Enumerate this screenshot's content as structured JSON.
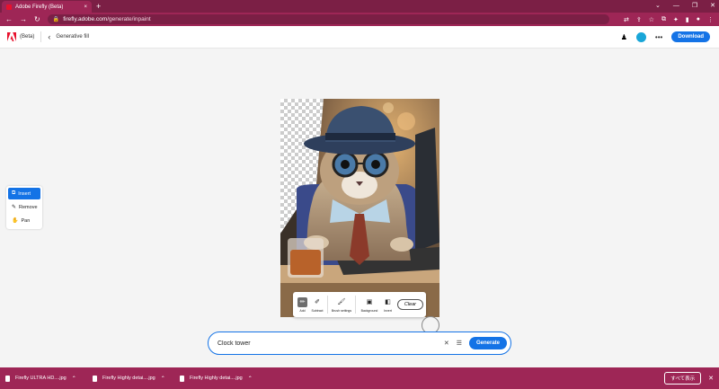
{
  "browser": {
    "tab_title": "Adobe Firefly (Beta)",
    "tab_close": "×",
    "new_tab": "+",
    "window_controls": [
      "⌄",
      "—",
      "❐",
      "✕"
    ],
    "url_domain": "firefly.adobe.com",
    "url_path": "/generate/inpaint"
  },
  "header": {
    "beta_label": "(Beta)",
    "breadcrumb": "Generative fill",
    "download_label": "Download"
  },
  "tools": [
    {
      "label": "Insert",
      "icon": "insert-icon",
      "active": true
    },
    {
      "label": "Remove",
      "icon": "remove-icon",
      "active": false
    },
    {
      "label": "Pan",
      "icon": "hand-icon",
      "active": false
    }
  ],
  "canvas_toolbar": {
    "add": "Add",
    "subtract": "Subtract",
    "brush": "Brush settings",
    "background": "Background",
    "invert": "Invert",
    "clear": "Clear"
  },
  "prompt": {
    "value": "Clock tower",
    "generate_label": "Generate"
  },
  "downloads": [
    {
      "name": "Firefly ULTRA HD....jpg"
    },
    {
      "name": "Firefly Highly detai....jpg"
    },
    {
      "name": "Firefly Highly detai....jpg"
    }
  ],
  "shelf": {
    "show_all": "すべて表示"
  },
  "colors": {
    "browser_theme": "#9e2656",
    "accent": "#1473e6",
    "adobe_red": "#e8112d"
  }
}
